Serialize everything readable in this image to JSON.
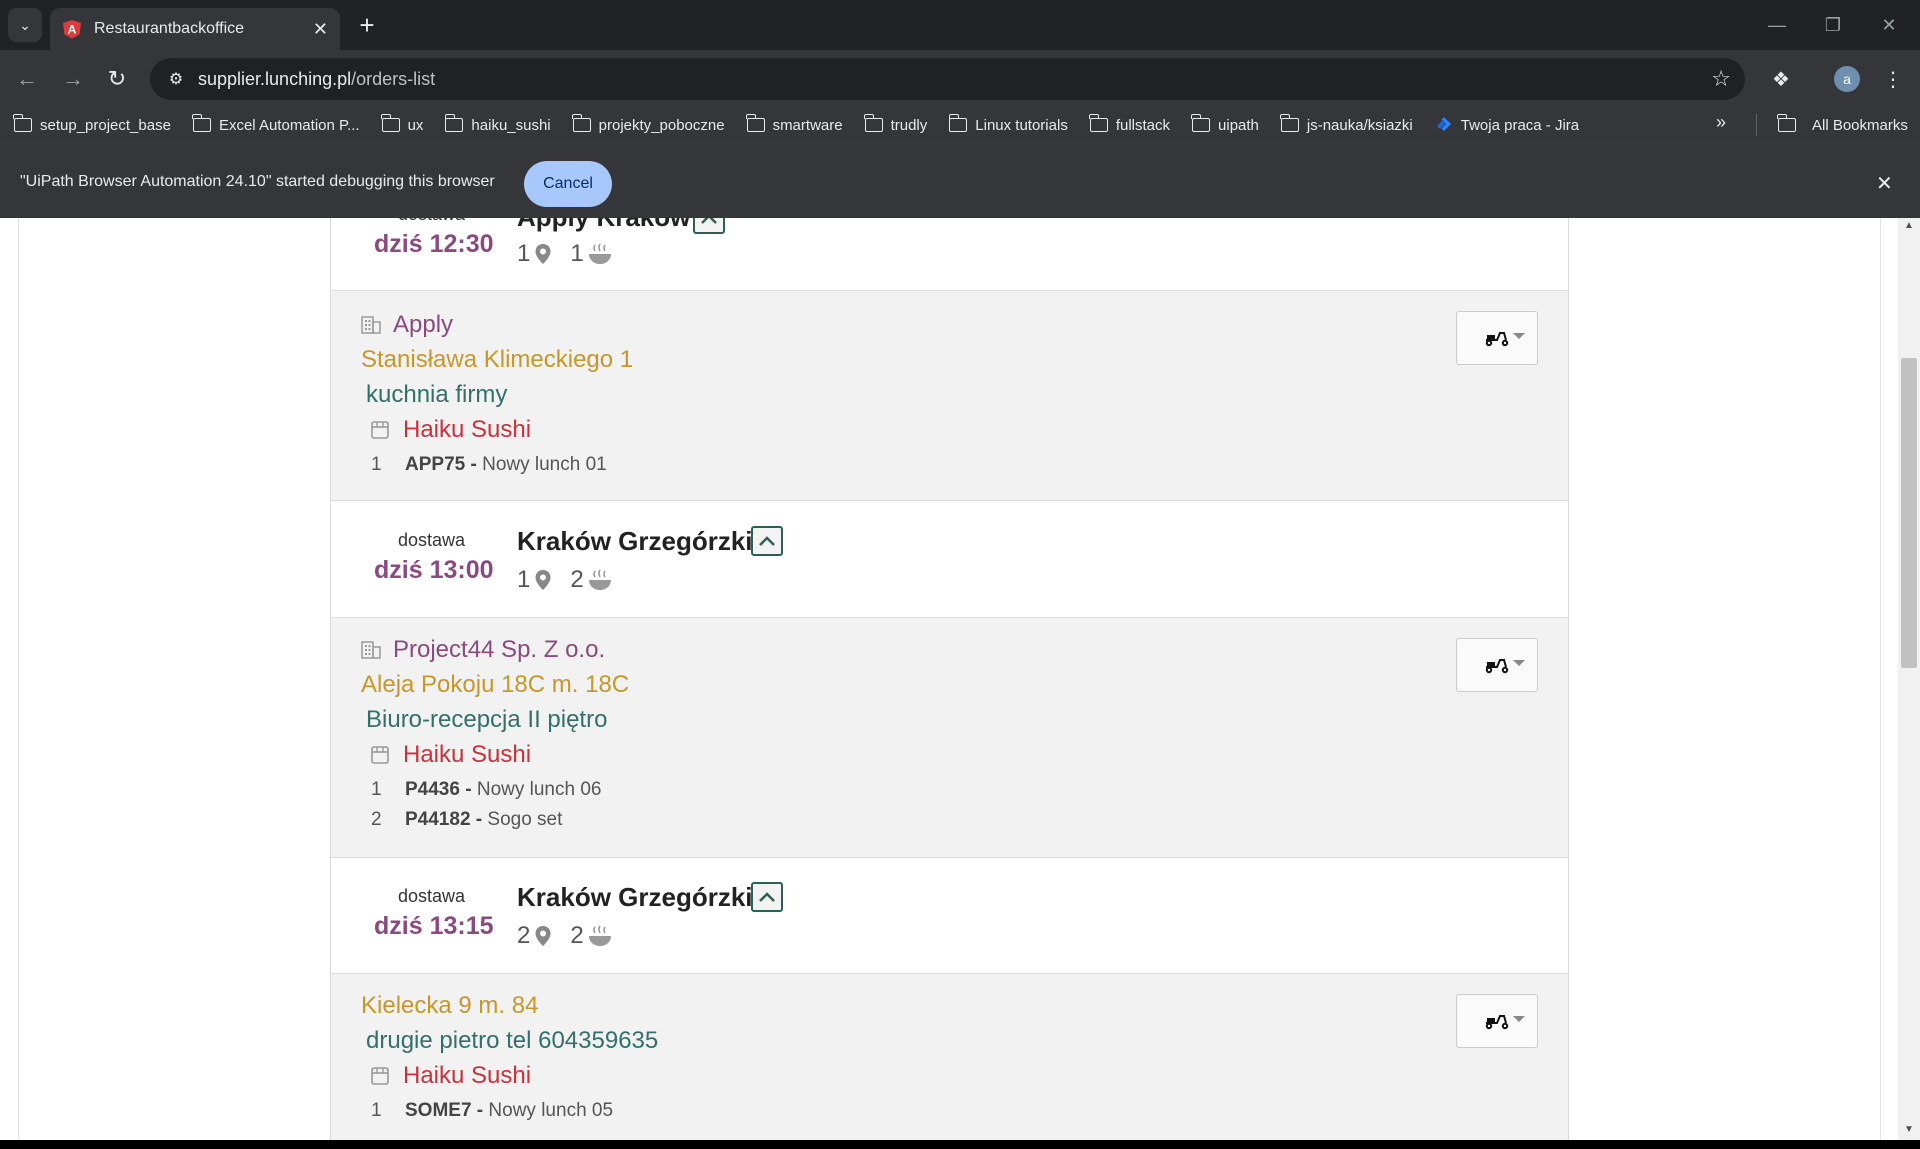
{
  "browser": {
    "tab_title": "Restaurantbackoffice",
    "url_host": "supplier.lunching.pl",
    "url_path": "/orders-list",
    "profile_initial": "a",
    "bookmarks": [
      "setup_project_base",
      "Excel Automation P...",
      "ux",
      "haiku_sushi",
      "projekty_poboczne",
      "smartware",
      "trudly",
      "Linux tutorials",
      "fullstack",
      "uipath",
      "js-nauka/ksiazki",
      "Twoja praca - Jira"
    ],
    "all_bookmarks": "All Bookmarks",
    "infobar_message": "\"UiPath Browser Automation 24.10\" started debugging this browser",
    "infobar_cancel": "Cancel"
  },
  "groups": [
    {
      "label": "dostawa",
      "time": "dziś 12:30",
      "zone": "Apply Kraków",
      "locations": "1",
      "meals": "1",
      "orders": [
        {
          "company": "Apply",
          "address": "Stanisława Klimeckiego 1",
          "note": "kuchnia firmy",
          "restaurant": "Haiku Sushi",
          "items": [
            {
              "qty": "1",
              "code": "APP75",
              "name": "Nowy lunch 01"
            }
          ]
        }
      ]
    },
    {
      "label": "dostawa",
      "time": "dziś 13:00",
      "zone": "Kraków Grzegórzki",
      "locations": "1",
      "meals": "2",
      "orders": [
        {
          "company": "Project44 Sp. Z o.o.",
          "address": "Aleja Pokoju 18C m. 18C",
          "note": "Biuro-recepcja II piętro",
          "restaurant": "Haiku Sushi",
          "items": [
            {
              "qty": "1",
              "code": "P4436",
              "name": "Nowy lunch 06"
            },
            {
              "qty": "2",
              "code": "P44182",
              "name": "Sogo set"
            }
          ]
        }
      ]
    },
    {
      "label": "dostawa",
      "time": "dziś 13:15",
      "zone": "Kraków Grzegórzki",
      "locations": "2",
      "meals": "2",
      "orders": [
        {
          "company": "",
          "address": "Kielecka 9 m. 84",
          "note": "drugie pietro tel 604359635",
          "restaurant": "Haiku Sushi",
          "items": [
            {
              "qty": "1",
              "code": "SOME7",
              "name": "Nowy lunch 05"
            }
          ]
        }
      ]
    }
  ],
  "colors": {
    "time": "#8b4a7f",
    "company": "#8b4a7f",
    "address": "#c9962a",
    "note": "#33706a",
    "restaurant": "#c8323c"
  }
}
